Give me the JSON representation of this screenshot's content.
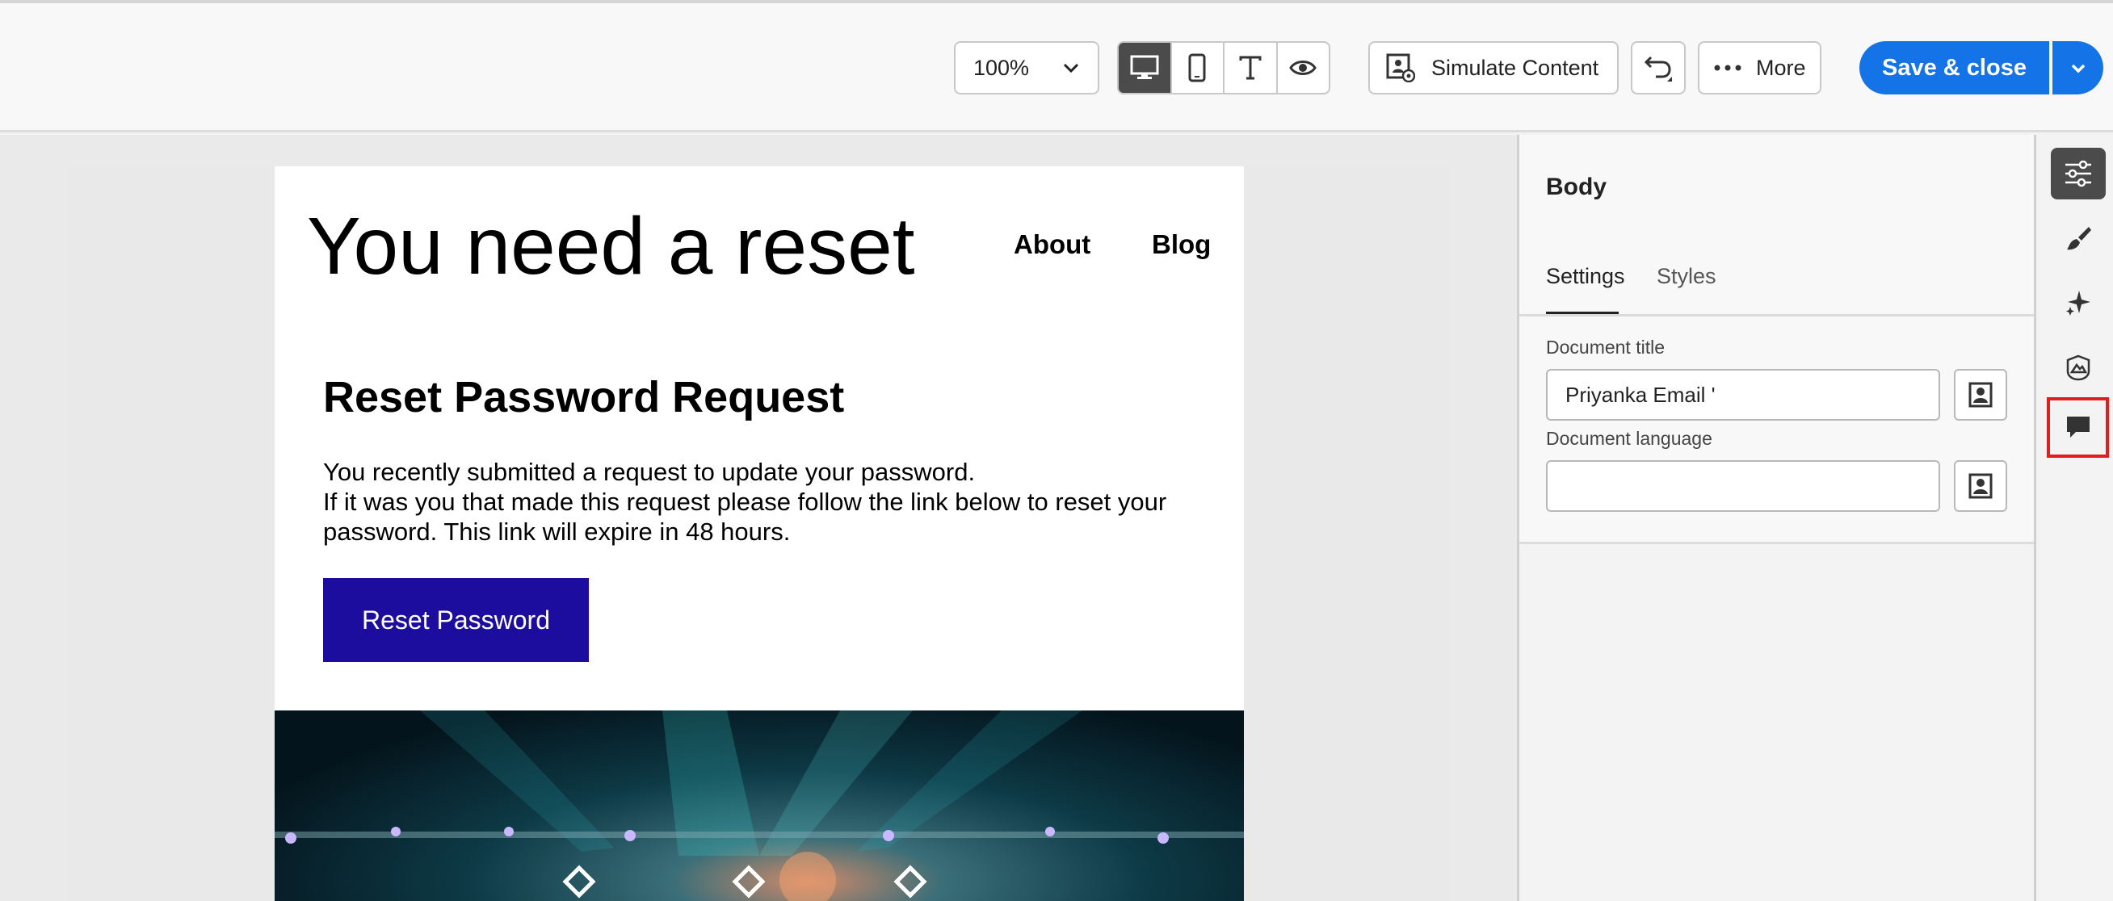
{
  "toolbar": {
    "zoom_value": "100%",
    "view_buttons": [
      "desktop-icon",
      "mobile-icon",
      "text-icon",
      "eye-icon"
    ],
    "simulate_label": "Simulate Content",
    "more_label": "More",
    "save_label": "Save & close"
  },
  "email": {
    "title": "You need a reset",
    "nav": [
      "About",
      "Blog"
    ],
    "heading": "Reset Password Request",
    "body_line1": "You recently submitted a request to update your password.",
    "body_line2": "If it was you that made this request please follow the link below to reset your password. This link will expire in 48 hours.",
    "cta_label": "Reset Password"
  },
  "panel": {
    "title": "Body",
    "tabs": [
      "Settings",
      "Styles"
    ],
    "active_tab": "Settings",
    "doc_title_label": "Document title",
    "doc_title_value": "Priyanka Email '",
    "doc_lang_label": "Document language",
    "doc_lang_value": ""
  },
  "rail": {
    "items": [
      "settings-sliders-icon",
      "brush-icon",
      "sparkle-icon",
      "image-asset-icon",
      "comment-icon"
    ],
    "active": "settings-sliders-icon",
    "highlighted": "comment-icon",
    "highlight_color": "#e01e1e"
  },
  "colors": {
    "primary": "#1473e6",
    "cta": "#1c0d9e"
  }
}
